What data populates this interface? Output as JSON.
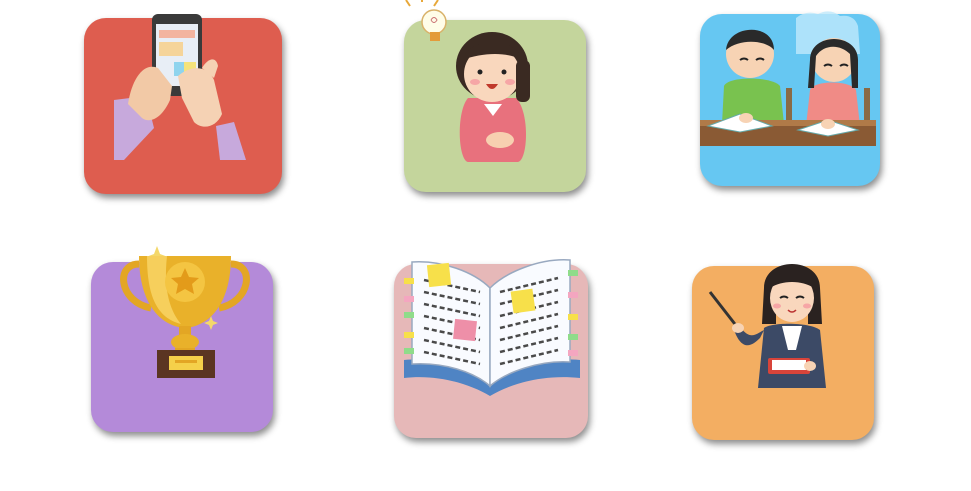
{
  "colors": {
    "tile_smartphone": "#de5d4f",
    "tile_idea": "#c4d59c",
    "tile_study": "#66c7f2",
    "tile_trophy": "#b48ad9",
    "tile_notebook": "#e6b8b8",
    "tile_teacher": "#f3ae62"
  },
  "icons": [
    "smartphone-hands-icon",
    "idea-girl-icon",
    "students-studying-icon",
    "trophy-icon",
    "open-notebook-icon",
    "teacher-pointer-icon"
  ]
}
